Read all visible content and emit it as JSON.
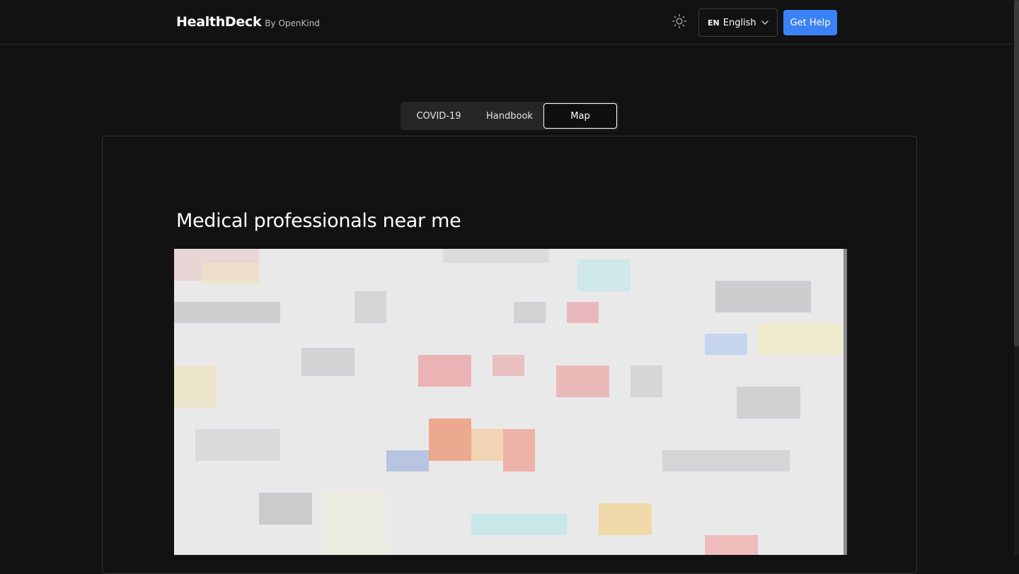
{
  "header": {
    "brand_name": "HealthDeck",
    "brand_sub": "By OpenKind",
    "theme_icon": "sun-icon",
    "language": {
      "code": "EN",
      "label": "English"
    },
    "help_button": "Get Help",
    "accent_color": "#3b82f6"
  },
  "tabs": [
    {
      "label": "COVID-19",
      "active": false
    },
    {
      "label": "Handbook",
      "active": false
    },
    {
      "label": "Map",
      "active": true
    }
  ],
  "main": {
    "title": "Medical professionals near me"
  }
}
